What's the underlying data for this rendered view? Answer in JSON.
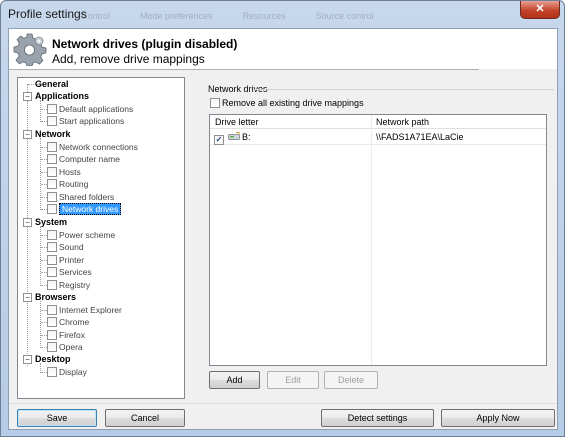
{
  "window": {
    "title": "Profile settings",
    "close_glyph": "✕",
    "background_tabs": [
      "Control",
      "Mode preferences",
      "Resources",
      "Source control"
    ]
  },
  "header": {
    "icon": "gear-icon",
    "title": "Network drives (plugin disabled)",
    "subtitle": "Add, remove drive mappings"
  },
  "tree": {
    "collapse_glyph": "−",
    "categories": [
      {
        "label": "General",
        "items": []
      },
      {
        "label": "Applications",
        "items": [
          "Default applications",
          "Start applications"
        ]
      },
      {
        "label": "Network",
        "items": [
          "Network connections",
          "Computer name",
          "Hosts",
          "Routing",
          "Shared folders",
          "Network drives"
        ]
      },
      {
        "label": "System",
        "items": [
          "Power scheme",
          "Sound",
          "Printer",
          "Services",
          "Registry"
        ]
      },
      {
        "label": "Browsers",
        "items": [
          "Internet Explorer",
          "Chrome",
          "Firefox",
          "Opera"
        ]
      },
      {
        "label": "Desktop",
        "items": [
          "Display"
        ]
      }
    ],
    "selected": "Network drives"
  },
  "panel": {
    "group_label": "Network drives",
    "remove_all_label": "Remove all existing drive mappings",
    "remove_all_checked": false,
    "columns": [
      "Drive letter",
      "Network path"
    ],
    "rows": [
      {
        "checked": true,
        "checkmark": "✓",
        "drive": "B:",
        "path": "\\\\FADS1A71EA\\LaCie"
      }
    ],
    "buttons": {
      "add": "Add",
      "edit": "Edit",
      "delete": "Delete"
    }
  },
  "footer": {
    "save": "Save",
    "cancel": "Cancel",
    "detect": "Detect settings",
    "apply": "Apply Now"
  },
  "colors": {
    "selection": "#3399ff",
    "accent": "#3c7fb1"
  }
}
